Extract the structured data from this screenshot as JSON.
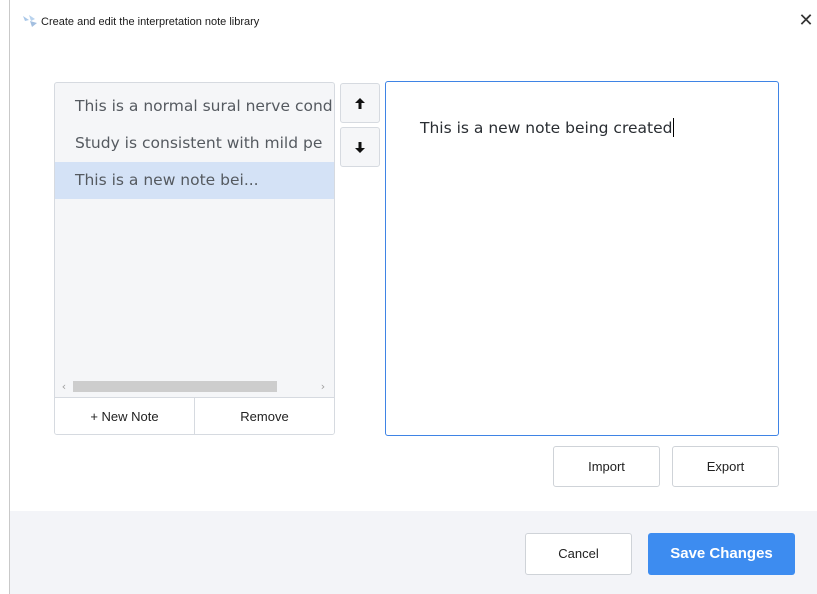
{
  "window": {
    "title": "Create and edit the interpretation note library",
    "close_glyph": "✕"
  },
  "notes_list": {
    "items": [
      {
        "label": "This is a normal sural nerve cond",
        "selected": false
      },
      {
        "label": "Study is consistent with mild pe",
        "selected": false
      },
      {
        "label": "This is a new note bei...",
        "selected": true
      }
    ],
    "scroll_left_glyph": "‹",
    "scroll_right_glyph": "›",
    "new_note_label": "+ New Note",
    "remove_label": "Remove"
  },
  "reorder": {
    "up_icon": "arrow-up-icon",
    "down_icon": "arrow-down-icon"
  },
  "editor": {
    "text": "This is a new note being created"
  },
  "actions": {
    "import_label": "Import",
    "export_label": "Export"
  },
  "footer": {
    "cancel_label": "Cancel",
    "save_label": "Save Changes"
  },
  "colors": {
    "accent": "#3d8cf0",
    "selected_row": "#d4e2f6",
    "editor_border": "#3f84e5"
  }
}
